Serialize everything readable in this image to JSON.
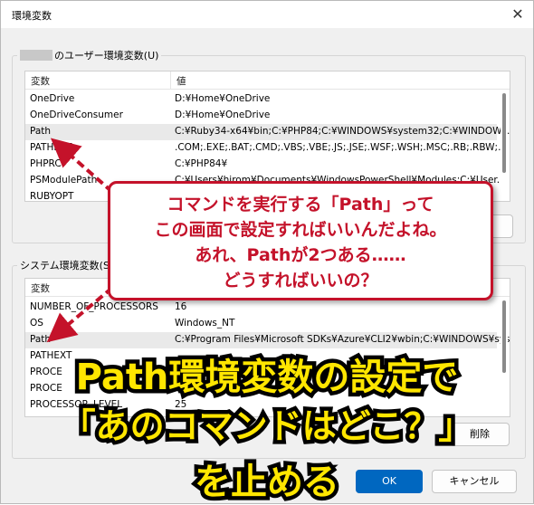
{
  "window": {
    "title": "環境変数",
    "close_glyph": "✕"
  },
  "user_vars": {
    "group_label": "のユーザー環境変数(U)",
    "headers": [
      "変数",
      "値"
    ],
    "rows": [
      {
        "name": "OneDrive",
        "value": "D:¥Home¥OneDrive"
      },
      {
        "name": "OneDriveConsumer",
        "value": "D:¥Home¥OneDrive"
      },
      {
        "name": "Path",
        "value": "C:¥Ruby34-x64¥bin;C:¥PHP84;C:¥WINDOWS¥system32;C:¥WINDOW..."
      },
      {
        "name": "PATHEXT",
        "value": ".COM;.EXE;.BAT;.CMD;.VBS;.VBE;.JS;.JSE;.WSF;.WSH;.MSC;.RB;.RBW;..."
      },
      {
        "name": "PHPRC",
        "value": "C:¥PHP84¥"
      },
      {
        "name": "PSModulePath",
        "value": "C:¥Users¥hirom¥Documents¥WindowsPowerShell¥Modules;C:¥User..."
      },
      {
        "name": "RUBYOPT",
        "value": ""
      }
    ]
  },
  "system_vars": {
    "group_label": "システム環境変数(S)",
    "headers": [
      "変数",
      "値"
    ],
    "rows": [
      {
        "name": "NUMBER_OF_PROCESSORS",
        "value": "16"
      },
      {
        "name": "OS",
        "value": "Windows_NT"
      },
      {
        "name": "Path",
        "value": "C:¥Program Files¥Microsoft SDKs¥Azure¥CLI2¥wbin;C:¥WINDOWS¥syste..."
      },
      {
        "name": "PATHEXT",
        "value": ""
      },
      {
        "name": "PROCE",
        "value": ""
      },
      {
        "name": "PROCE",
        "value": ""
      },
      {
        "name": "PROCESSOR_LEVEL",
        "value": "25"
      }
    ],
    "delete_button": "削除"
  },
  "buttons": {
    "ok": "OK",
    "cancel": "キャンセル"
  },
  "callout": {
    "lines": [
      "コマンドを実行する「Path」って",
      "この画面で設定すればいいんだよね。",
      "あれ、Pathが2つある……",
      "どうすればいいの？"
    ]
  },
  "headline": {
    "lines": [
      "Path環境変数の設定で",
      "「あのコマンドはどこ？」",
      "を止める"
    ]
  },
  "colors": {
    "callout_red": "#c4122a",
    "headline_yellow": "#ffe600",
    "ok_blue": "#0067c0"
  }
}
